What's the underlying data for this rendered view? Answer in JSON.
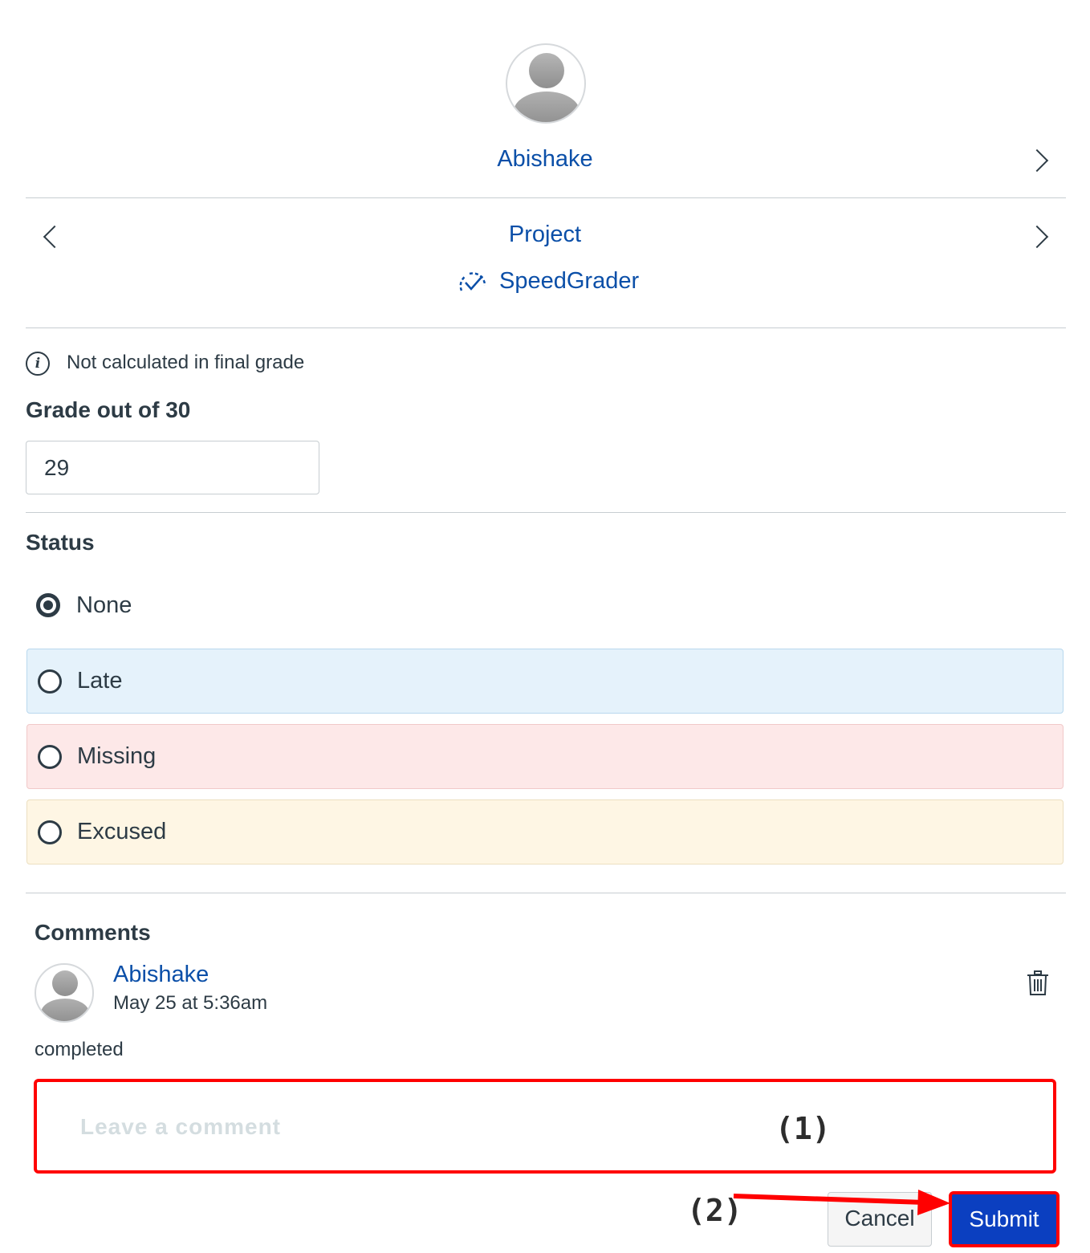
{
  "header": {
    "student_name": "Abishake",
    "assignment_name": "Project",
    "speedgrader_label": "SpeedGrader"
  },
  "grade": {
    "info_text": "Not calculated in final grade",
    "label": "Grade out of 30",
    "value": "29"
  },
  "status": {
    "heading": "Status",
    "options": [
      {
        "label": "None",
        "selected": true,
        "color": "#ffffff"
      },
      {
        "label": "Late",
        "selected": false,
        "color": "#e5f2fb"
      },
      {
        "label": "Missing",
        "selected": false,
        "color": "#fde8e8"
      },
      {
        "label": "Excused",
        "selected": false,
        "color": "#fef6e4"
      }
    ]
  },
  "comments": {
    "heading": "Comments",
    "items": [
      {
        "author": "Abishake",
        "timestamp": "May 25 at 5:36am",
        "text": "completed"
      }
    ],
    "input_placeholder": "Leave a comment"
  },
  "actions": {
    "cancel_label": "Cancel",
    "submit_label": "Submit"
  },
  "annotations": {
    "step1": "(1)",
    "step2": "(2)",
    "highlight_color": "#ff0000"
  },
  "colors": {
    "link": "#0b4fa8",
    "submit_bg": "#0b3fc0"
  },
  "icons": [
    "chevron-right-icon",
    "chevron-left-icon",
    "speedgrader-icon",
    "info-icon",
    "trash-icon",
    "avatar-icon"
  ]
}
